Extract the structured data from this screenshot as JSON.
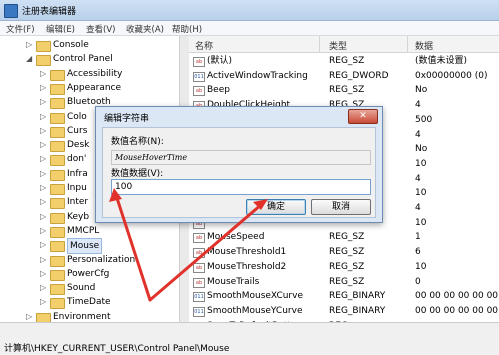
{
  "window": {
    "title": "注册表编辑器"
  },
  "menu": [
    "文件(F)",
    "编辑(E)",
    "查看(V)",
    "收藏夹(A)",
    "帮助(H)"
  ],
  "tree": [
    {
      "label": "Console",
      "indent": 1
    },
    {
      "label": "Control Panel",
      "indent": 1,
      "expanded": true
    },
    {
      "label": "Accessibility",
      "indent": 2
    },
    {
      "label": "Appearance",
      "indent": 2
    },
    {
      "label": "Bluetooth",
      "indent": 2
    },
    {
      "label": "Colo",
      "indent": 2
    },
    {
      "label": "Curs",
      "indent": 2
    },
    {
      "label": "Desk",
      "indent": 2
    },
    {
      "label": "don'",
      "indent": 2
    },
    {
      "label": "Infra",
      "indent": 2
    },
    {
      "label": "Inpu",
      "indent": 2
    },
    {
      "label": "Inter",
      "indent": 2
    },
    {
      "label": "Keyb",
      "indent": 2
    },
    {
      "label": "MMCPL",
      "indent": 2
    },
    {
      "label": "Mouse",
      "indent": 2,
      "selected": true
    },
    {
      "label": "Personalization",
      "indent": 2
    },
    {
      "label": "PowerCfg",
      "indent": 2
    },
    {
      "label": "Sound",
      "indent": 2
    },
    {
      "label": "TimeDate",
      "indent": 2
    },
    {
      "label": "Environment",
      "indent": 1
    }
  ],
  "columns": {
    "name": "名称",
    "type": "类型",
    "data": "数据"
  },
  "values": [
    {
      "name": "(默认)",
      "type": "REG_SZ",
      "data": "(数值未设置)",
      "kind": "sz"
    },
    {
      "name": "ActiveWindowTracking",
      "type": "REG_DWORD",
      "data": "0x00000000 (0)",
      "kind": "bin"
    },
    {
      "name": "Beep",
      "type": "REG_SZ",
      "data": "No",
      "kind": "sz"
    },
    {
      "name": "DoubleClickHeight",
      "type": "REG_SZ",
      "data": "4",
      "kind": "sz"
    },
    {
      "name": "",
      "type": "",
      "data": "500",
      "kind": "sz"
    },
    {
      "name": "",
      "type": "",
      "data": "4",
      "kind": "sz"
    },
    {
      "name": "",
      "type": "",
      "data": "No",
      "kind": "sz"
    },
    {
      "name": "",
      "type": "",
      "data": "10",
      "kind": "sz"
    },
    {
      "name": "",
      "type": "",
      "data": "4",
      "kind": "sz"
    },
    {
      "name": "",
      "type": "",
      "data": "10",
      "kind": "sz"
    },
    {
      "name": "",
      "type": "",
      "data": "4",
      "kind": "sz"
    },
    {
      "name": "",
      "type": "",
      "data": "10",
      "kind": "sz"
    },
    {
      "name": "MouseSpeed",
      "type": "REG_SZ",
      "data": "1",
      "kind": "sz"
    },
    {
      "name": "MouseThreshold1",
      "type": "REG_SZ",
      "data": "6",
      "kind": "sz"
    },
    {
      "name": "MouseThreshold2",
      "type": "REG_SZ",
      "data": "10",
      "kind": "sz"
    },
    {
      "name": "MouseTrails",
      "type": "REG_SZ",
      "data": "0",
      "kind": "sz"
    },
    {
      "name": "SmoothMouseXCurve",
      "type": "REG_BINARY",
      "data": "00 00 00 00 00 00",
      "kind": "bin"
    },
    {
      "name": "SmoothMouseYCurve",
      "type": "REG_BINARY",
      "data": "00 00 00 00 00 00",
      "kind": "bin"
    },
    {
      "name": "SnapToDefaultButton",
      "type": "REG",
      "data": "",
      "kind": "sz"
    }
  ],
  "status": {
    "path": "计算机\\HKEY_CURRENT_USER\\Control Panel\\Mouse"
  },
  "dialog": {
    "title": "编辑字符串",
    "close": "✕",
    "name_label": "数值名称(N):",
    "name_value": "MouseHoverTime",
    "data_label": "数值数据(V):",
    "data_value": "100",
    "ok": "确定",
    "cancel": "取消"
  }
}
